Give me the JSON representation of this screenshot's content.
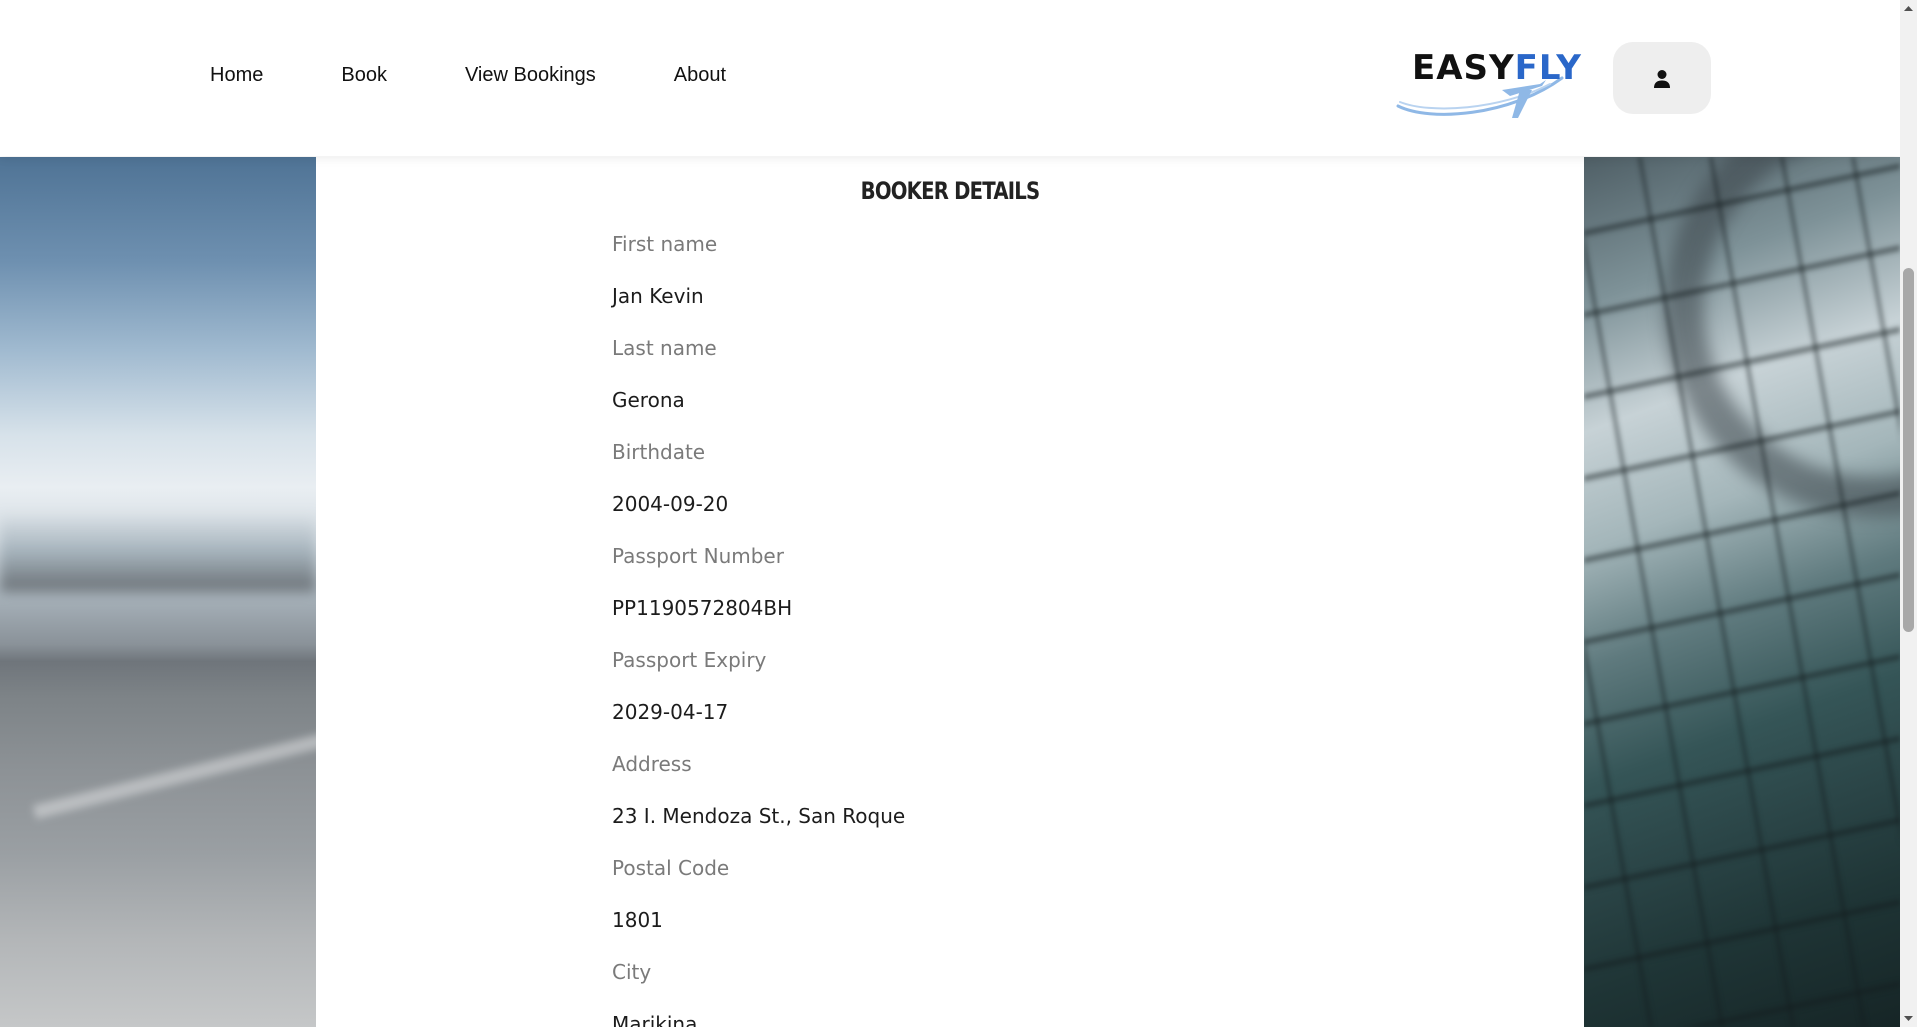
{
  "nav": {
    "links": [
      {
        "label": "Home"
      },
      {
        "label": "Book"
      },
      {
        "label": "View Bookings"
      },
      {
        "label": "About"
      }
    ]
  },
  "logo": {
    "part1": "EASY",
    "part2": "FLY",
    "colors": {
      "easy": "#111111",
      "fly": "#2a67c9",
      "swoosh": "#8fb8e6"
    }
  },
  "user_menu": {
    "icon": "user-icon"
  },
  "booker": {
    "title": "BOOKER DETAILS",
    "fields": [
      {
        "label": "First name",
        "value": "Jan Kevin"
      },
      {
        "label": "Last name",
        "value": "Gerona"
      },
      {
        "label": "Birthdate",
        "value": "2004-09-20"
      },
      {
        "label": "Passport Number",
        "value": "PP1190572804BH"
      },
      {
        "label": "Passport Expiry",
        "value": "2029-04-17"
      },
      {
        "label": "Address",
        "value": "23 I. Mendoza St., San Roque"
      },
      {
        "label": "Postal Code",
        "value": "1801"
      },
      {
        "label": "City",
        "value": "Marikina"
      }
    ]
  }
}
